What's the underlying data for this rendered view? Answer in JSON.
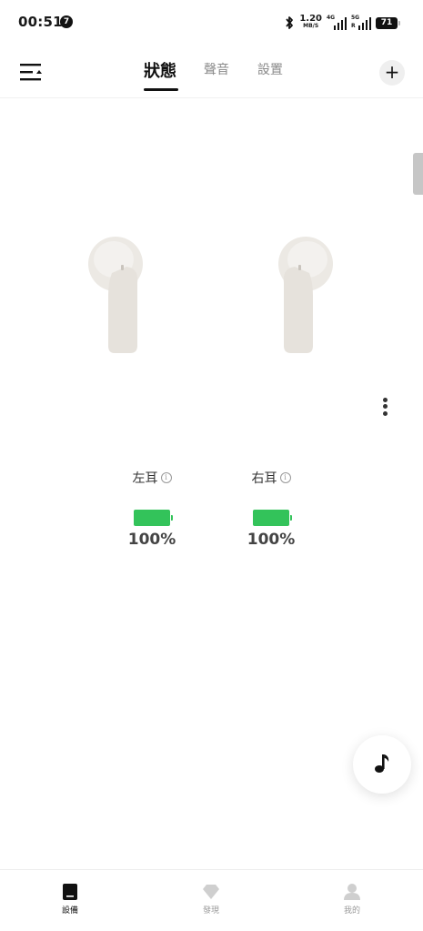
{
  "status_bar": {
    "time": "00:51",
    "notification_count": "7",
    "speed_value": "1.20",
    "speed_unit": "MB/S",
    "network_1": "4G",
    "network_2": "5G",
    "roaming_mark": "R",
    "battery_level": "71"
  },
  "header": {
    "tabs": [
      {
        "label": "狀態",
        "active": true
      },
      {
        "label": "聲音",
        "active": false
      },
      {
        "label": "設置",
        "active": false
      }
    ],
    "add_label": "+"
  },
  "earbuds": {
    "left": {
      "label": "左耳",
      "battery_percent": 100,
      "battery_text": "100%"
    },
    "right": {
      "label": "右耳",
      "battery_percent": 100,
      "battery_text": "100%"
    }
  },
  "colors": {
    "battery_green": "#33c35a",
    "earbud_body": "#ece9e4",
    "accent": "#111111"
  },
  "bottom_nav": [
    {
      "label": "設備",
      "icon": "device-icon",
      "active": true
    },
    {
      "label": "發現",
      "icon": "diamond-icon",
      "active": false
    },
    {
      "label": "我的",
      "icon": "person-icon",
      "active": false
    }
  ]
}
